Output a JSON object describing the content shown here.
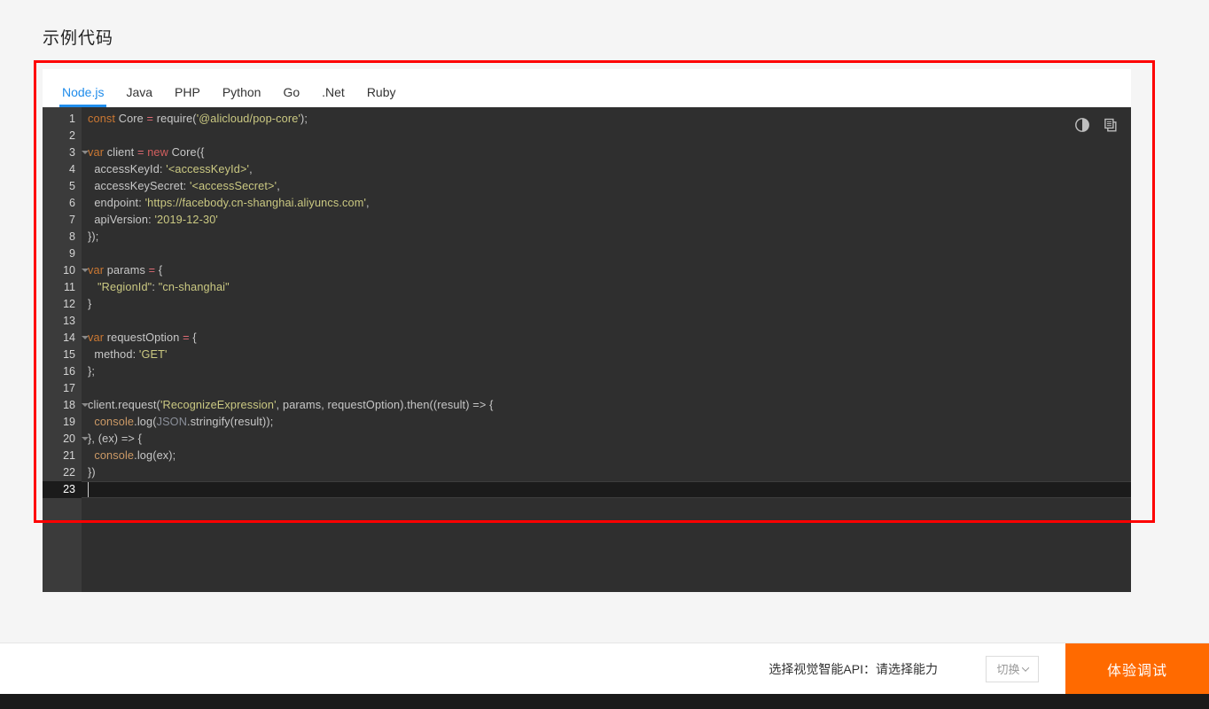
{
  "page": {
    "title": "示例代码",
    "background_color": "#f5f5f5",
    "highlight_box_color": "#fe0000"
  },
  "language_tabs": [
    {
      "label": "Node.js",
      "active": true
    },
    {
      "label": "Java",
      "active": false
    },
    {
      "label": "PHP",
      "active": false
    },
    {
      "label": "Python",
      "active": false
    },
    {
      "label": "Go",
      "active": false
    },
    {
      "label": ".Net",
      "active": false
    },
    {
      "label": "Ruby",
      "active": false
    }
  ],
  "editor": {
    "theme_toggle_icon": "contrast-icon",
    "copy_icon": "copy-icon",
    "active_line": 23,
    "total_lines": 23,
    "background_color": "#2f2f2f",
    "gutter_color": "#3b3b3b",
    "lines": [
      {
        "n": 1,
        "fold": false,
        "tokens": [
          {
            "t": "const ",
            "c": "kw"
          },
          {
            "t": "Core ",
            "c": "plain"
          },
          {
            "t": "=",
            "c": "op"
          },
          {
            "t": " require(",
            "c": "plain"
          },
          {
            "t": "'@alicloud/pop-core'",
            "c": "str"
          },
          {
            "t": ");",
            "c": "plain"
          }
        ]
      },
      {
        "n": 2,
        "fold": false,
        "tokens": []
      },
      {
        "n": 3,
        "fold": true,
        "tokens": [
          {
            "t": "var ",
            "c": "kw"
          },
          {
            "t": "client ",
            "c": "plain"
          },
          {
            "t": "=",
            "c": "op"
          },
          {
            "t": " ",
            "c": "plain"
          },
          {
            "t": "new",
            "c": "kw2"
          },
          {
            "t": " Core({",
            "c": "plain"
          }
        ]
      },
      {
        "n": 4,
        "fold": false,
        "tokens": [
          {
            "t": "  accessKeyId: ",
            "c": "plain"
          },
          {
            "t": "'<accessKeyId>'",
            "c": "str"
          },
          {
            "t": ",",
            "c": "plain"
          }
        ]
      },
      {
        "n": 5,
        "fold": false,
        "tokens": [
          {
            "t": "  accessKeySecret: ",
            "c": "plain"
          },
          {
            "t": "'<accessSecret>'",
            "c": "str"
          },
          {
            "t": ",",
            "c": "plain"
          }
        ]
      },
      {
        "n": 6,
        "fold": false,
        "tokens": [
          {
            "t": "  endpoint: ",
            "c": "plain"
          },
          {
            "t": "'https://facebody.cn-shanghai.aliyuncs.com'",
            "c": "str"
          },
          {
            "t": ",",
            "c": "plain"
          }
        ]
      },
      {
        "n": 7,
        "fold": false,
        "tokens": [
          {
            "t": "  apiVersion: ",
            "c": "plain"
          },
          {
            "t": "'2019-12-30'",
            "c": "str"
          }
        ]
      },
      {
        "n": 8,
        "fold": false,
        "tokens": [
          {
            "t": "});",
            "c": "plain"
          }
        ]
      },
      {
        "n": 9,
        "fold": false,
        "tokens": []
      },
      {
        "n": 10,
        "fold": true,
        "tokens": [
          {
            "t": "var ",
            "c": "kw"
          },
          {
            "t": "params ",
            "c": "plain"
          },
          {
            "t": "=",
            "c": "op"
          },
          {
            "t": " {",
            "c": "plain"
          }
        ]
      },
      {
        "n": 11,
        "fold": false,
        "tokens": [
          {
            "t": "   ",
            "c": "plain"
          },
          {
            "t": "\"RegionId\"",
            "c": "str"
          },
          {
            "t": ": ",
            "c": "plain"
          },
          {
            "t": "\"cn-shanghai\"",
            "c": "str"
          }
        ]
      },
      {
        "n": 12,
        "fold": false,
        "tokens": [
          {
            "t": "}",
            "c": "plain"
          }
        ]
      },
      {
        "n": 13,
        "fold": false,
        "tokens": []
      },
      {
        "n": 14,
        "fold": true,
        "tokens": [
          {
            "t": "var ",
            "c": "kw"
          },
          {
            "t": "requestOption ",
            "c": "plain"
          },
          {
            "t": "=",
            "c": "op"
          },
          {
            "t": " {",
            "c": "plain"
          }
        ]
      },
      {
        "n": 15,
        "fold": false,
        "tokens": [
          {
            "t": "  method: ",
            "c": "plain"
          },
          {
            "t": "'GET'",
            "c": "str"
          }
        ]
      },
      {
        "n": 16,
        "fold": false,
        "tokens": [
          {
            "t": "};",
            "c": "plain"
          }
        ]
      },
      {
        "n": 17,
        "fold": false,
        "tokens": []
      },
      {
        "n": 18,
        "fold": true,
        "tokens": [
          {
            "t": "client.request(",
            "c": "plain"
          },
          {
            "t": "'RecognizeExpression'",
            "c": "str"
          },
          {
            "t": ", params, requestOption).then((result) => {",
            "c": "plain"
          }
        ]
      },
      {
        "n": 19,
        "fold": false,
        "tokens": [
          {
            "t": "  console",
            "c": "obj"
          },
          {
            "t": ".log(",
            "c": "plain"
          },
          {
            "t": "JSON",
            "c": "dim"
          },
          {
            "t": ".stringify(result));",
            "c": "plain"
          }
        ]
      },
      {
        "n": 20,
        "fold": true,
        "tokens": [
          {
            "t": "}, (ex) => {",
            "c": "plain"
          }
        ]
      },
      {
        "n": 21,
        "fold": false,
        "tokens": [
          {
            "t": "  console",
            "c": "obj"
          },
          {
            "t": ".log(ex);",
            "c": "plain"
          }
        ]
      },
      {
        "n": 22,
        "fold": false,
        "tokens": [
          {
            "t": "})",
            "c": "plain"
          }
        ]
      },
      {
        "n": 23,
        "fold": false,
        "tokens": []
      }
    ]
  },
  "footer": {
    "api_label": "选择视觉智能API：请选择能力",
    "switch_button": "切换",
    "primary_button": "体验调试",
    "primary_button_color": "#ff6a00"
  }
}
